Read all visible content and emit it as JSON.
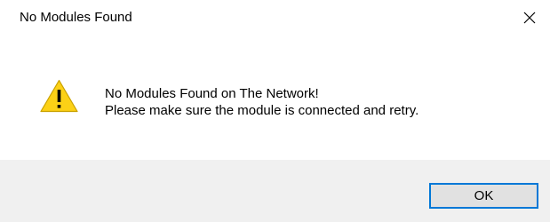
{
  "window": {
    "title": "No Modules Found",
    "close_icon": "close-icon"
  },
  "message": {
    "icon": "warning-icon",
    "line1": "No Modules Found on The Network!",
    "line2": "Please make sure the module is connected and retry."
  },
  "footer": {
    "ok_label": "OK"
  },
  "colors": {
    "accent": "#0078d7",
    "warning": "#fcd116",
    "footer_bg": "#f0f0f0"
  }
}
